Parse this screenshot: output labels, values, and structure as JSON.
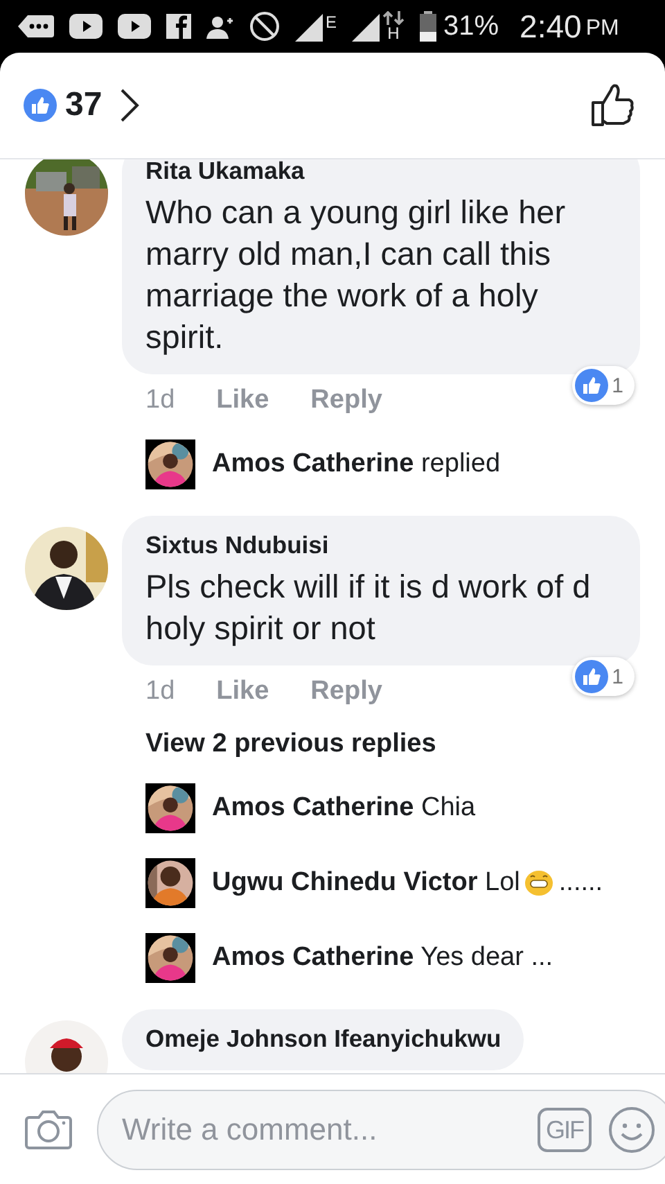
{
  "status_bar": {
    "network_1": "E",
    "network_2": "H",
    "battery": "31%",
    "time": "2:40",
    "meridiem": "PM"
  },
  "header": {
    "reaction_count": "37"
  },
  "comments": [
    {
      "name": "Rita Ukamaka",
      "text": "Who can a young girl like her marry old man,I can call this marriage the work of a holy spirit.",
      "time": "1d",
      "like": "Like",
      "reply": "Reply",
      "reactions": "1",
      "replies": [
        {
          "kind": "text",
          "name": "Amos Catherine",
          "text": "replied"
        }
      ]
    },
    {
      "name": "Sixtus Ndubuisi",
      "text": "Pls check will if it is d work of d holy spirit or not",
      "time": "1d",
      "like": "Like",
      "reply": "Reply",
      "reactions": "1",
      "view_previous": "View 2 previous replies",
      "replies": [
        {
          "kind": "text",
          "name": "Amos Catherine",
          "text": "Chia"
        },
        {
          "kind": "emoji",
          "name": "Ugwu Chinedu Victor",
          "text": "Lol",
          "suffix": "......"
        },
        {
          "kind": "text",
          "name": "Amos Catherine",
          "text": "Yes dear ..."
        }
      ]
    },
    {
      "name": "Omeje Johnson Ifeanyichukwu"
    }
  ],
  "composer": {
    "placeholder": "Write a comment...",
    "gif": "GIF"
  }
}
